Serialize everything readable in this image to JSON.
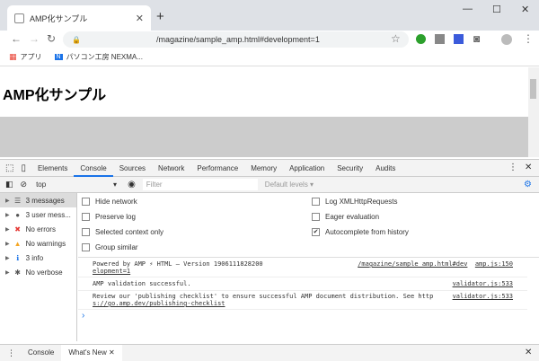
{
  "browser": {
    "tab_title": "AMP化サンプル",
    "new_tab": "+",
    "url": "/magazine/sample_amp.html#development=1"
  },
  "bookmarks": [
    {
      "label": "アプリ"
    },
    {
      "label": "パソコン工房 NEXMA..."
    }
  ],
  "page": {
    "heading": "AMP化サンプル"
  },
  "devtools": {
    "tabs": [
      "Elements",
      "Console",
      "Sources",
      "Network",
      "Performance",
      "Memory",
      "Application",
      "Security",
      "Audits"
    ],
    "active_tab": "Console",
    "context": "top",
    "filter_placeholder": "Filter",
    "levels": "Default levels ▾",
    "sidebar": [
      {
        "label": "3 messages",
        "icon": "list-icon",
        "color": "#555"
      },
      {
        "label": "3 user mess...",
        "icon": "user-icon",
        "color": "#555"
      },
      {
        "label": "No errors",
        "icon": "error-icon",
        "color": "#e53935"
      },
      {
        "label": "No warnings",
        "icon": "warning-icon",
        "color": "#f5a623"
      },
      {
        "label": "3 info",
        "icon": "info-icon",
        "color": "#1a73e8"
      },
      {
        "label": "No verbose",
        "icon": "bug-icon",
        "color": "#555"
      }
    ],
    "settings_left": [
      {
        "label": "Hide network",
        "checked": false
      },
      {
        "label": "Preserve log",
        "checked": false
      },
      {
        "label": "Selected context only",
        "checked": false
      },
      {
        "label": "Group similar",
        "checked": false
      }
    ],
    "settings_right": [
      {
        "label": "Log XMLHttpRequests",
        "checked": false
      },
      {
        "label": "Eager evaluation",
        "checked": false
      },
      {
        "label": "Autocomplete from history",
        "checked": true
      }
    ],
    "messages": [
      {
        "text1": "Powered by AMP ⚡ HTML – Version 1906111828200",
        "link1": "/magazine/sample_amp.html#dev",
        "src": "amp.js:150",
        "cont": "elopment=1"
      },
      {
        "text1": "AMP validation successful.",
        "src": "validator.js:533"
      },
      {
        "text1": "Review our 'publishing checklist' to ensure successful AMP document distribution. See http",
        "src": "validator.js:533",
        "cont": "s://go.amp.dev/publishing-checklist"
      }
    ],
    "prompt": "›",
    "bottom_tabs": [
      "Console",
      "What's New"
    ]
  }
}
